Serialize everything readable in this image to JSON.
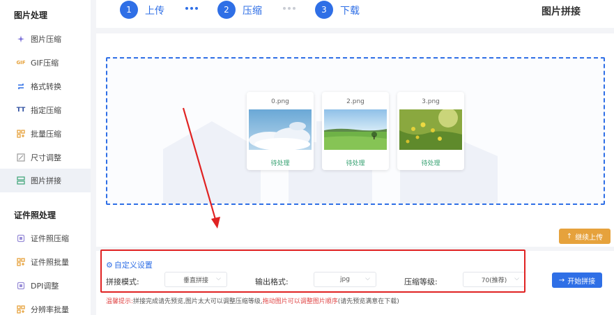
{
  "sidebar": {
    "section1_title": "图片处理",
    "items1": [
      {
        "label": "图片压缩",
        "icon": "compress-icon"
      },
      {
        "label": "GIF压缩",
        "icon": "gif-icon"
      },
      {
        "label": "格式转换",
        "icon": "convert-icon"
      },
      {
        "label": "指定压缩",
        "icon": "text-size-icon"
      },
      {
        "label": "批量压缩",
        "icon": "batch-icon"
      },
      {
        "label": "尺寸调整",
        "icon": "resize-icon"
      },
      {
        "label": "图片拼接",
        "icon": "stitch-icon"
      }
    ],
    "section2_title": "证件照处理",
    "items2": [
      {
        "label": "证件照压缩",
        "icon": "id-compress-icon"
      },
      {
        "label": "证件照批量",
        "icon": "id-batch-icon"
      },
      {
        "label": "DPI调整",
        "icon": "dpi-icon"
      },
      {
        "label": "分辨率批量",
        "icon": "resolution-icon"
      }
    ],
    "icon_text": {
      "gif": "GIF",
      "tt": "TT"
    }
  },
  "steps": [
    {
      "num": "1",
      "label": "上传"
    },
    {
      "num": "2",
      "label": "压缩"
    },
    {
      "num": "3",
      "label": "下载"
    }
  ],
  "page_title": "图片拼接",
  "files": [
    {
      "name": "0.png",
      "status": "待处理"
    },
    {
      "name": "2.png",
      "status": "待处理"
    },
    {
      "name": "3.png",
      "status": "待处理"
    }
  ],
  "continue_upload": "继续上传",
  "settings": {
    "title": "自定义设置",
    "mode_label": "拼接模式:",
    "mode_value": "垂直拼接",
    "format_label": "输出格式:",
    "format_value": "jpg",
    "level_label": "压缩等级:",
    "level_value": "70(推荐)",
    "start_button": "开始拼接"
  },
  "hint": {
    "prefix": "温馨提示:",
    "text1": "拼接完成请先预览,图片太大可以调整压缩等级,",
    "highlight": "拖动图片可以调整图片顺序",
    "text2": "(请先预览满意在下载)"
  },
  "colors": {
    "primary": "#2f6fe6",
    "warning": "#e6a23c",
    "annotation": "#e02222",
    "pending": "#3aa374"
  }
}
